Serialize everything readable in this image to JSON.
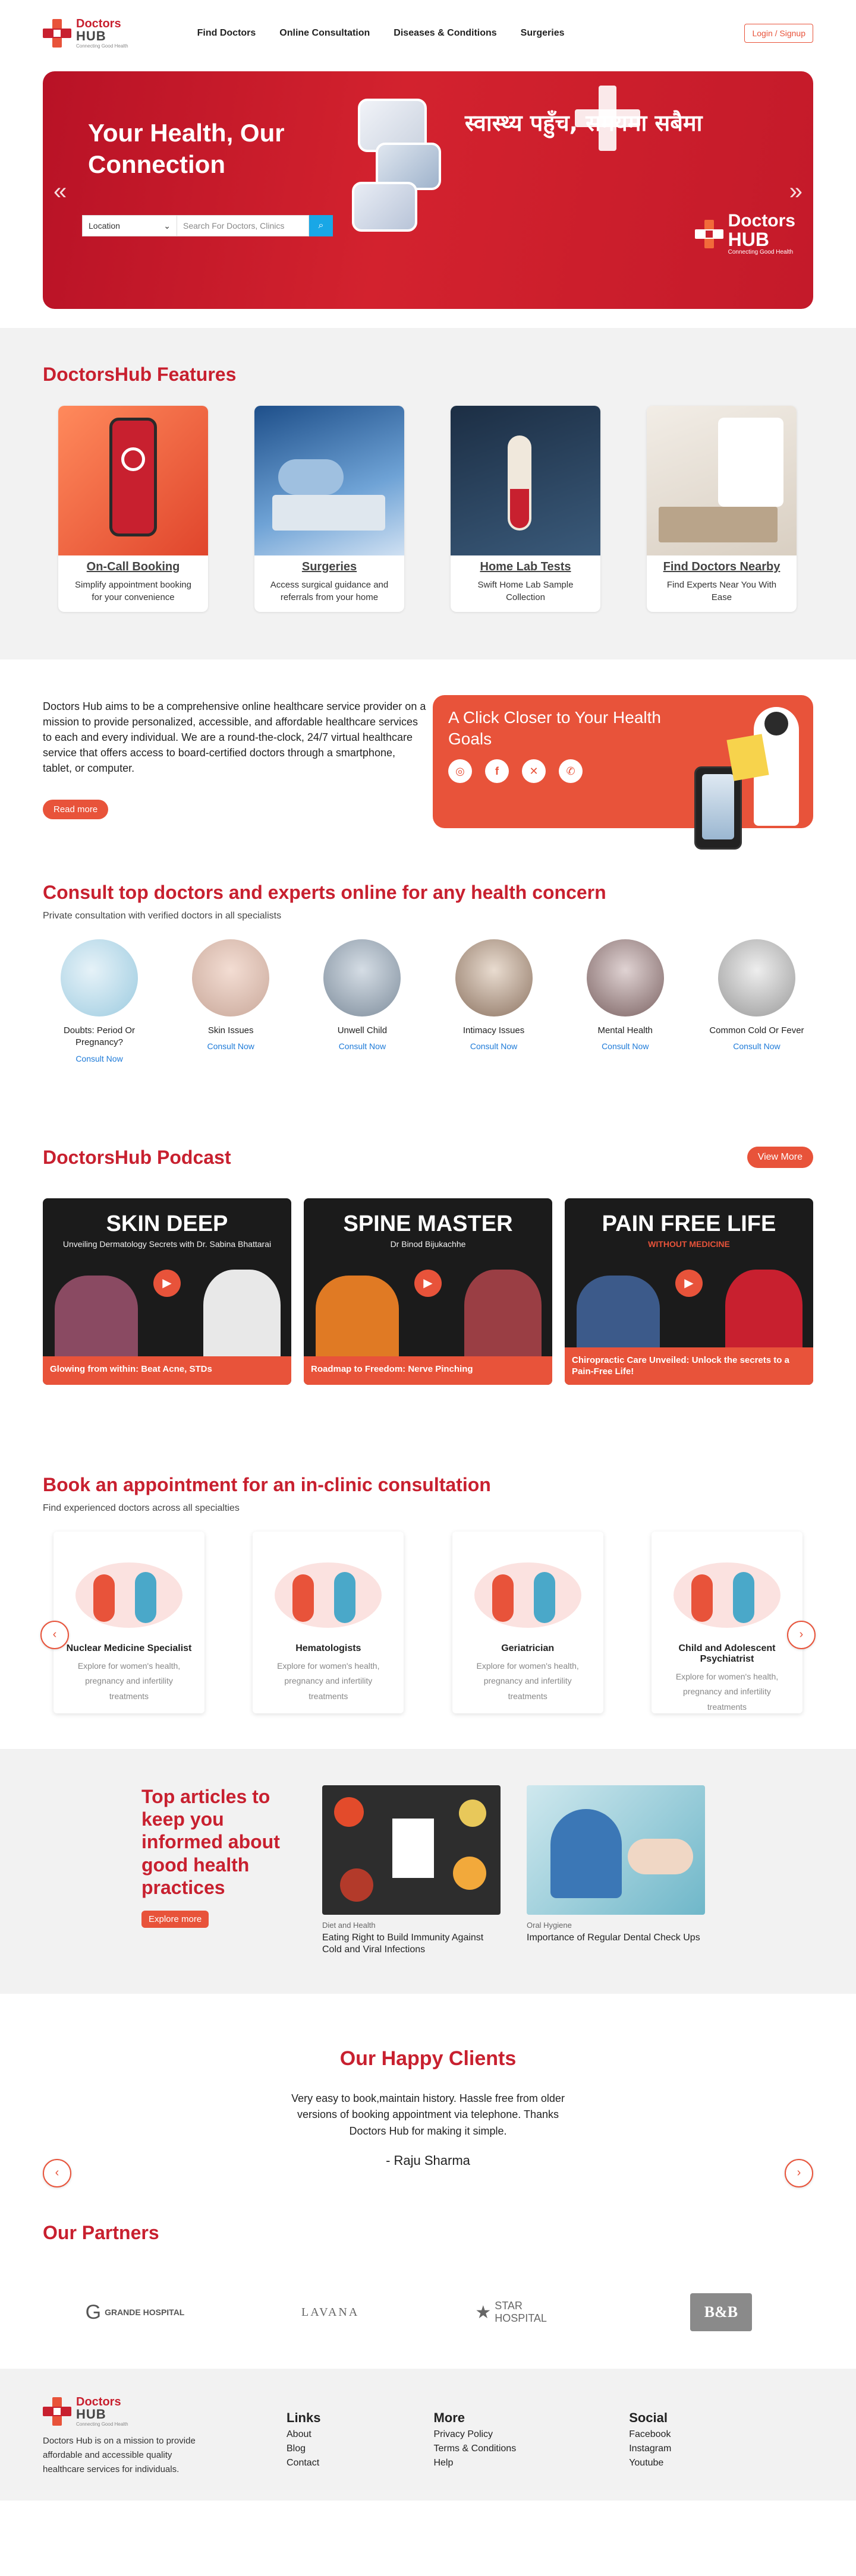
{
  "header": {
    "logo_line1": "Doctors",
    "logo_line2": "HUB",
    "logo_tag": "Connecting Good Health",
    "nav": [
      "Find Doctors",
      "Online Consultation",
      "Diseases & Conditions",
      "Surgeries"
    ],
    "login": "Login / Signup"
  },
  "hero": {
    "title": "Your Health, Our Connection",
    "location_label": "Location",
    "search_placeholder": "Search For Doctors, Clinics",
    "nepali": "स्वास्थ्य पहुँच, समयमा सबैमा",
    "badge_line1": "Doctors",
    "badge_line2": "HUB",
    "badge_tag": "Connecting Good Health"
  },
  "features": {
    "title": "DoctorsHub Features",
    "items": [
      {
        "title": "On-Call Booking",
        "desc": "Simplify appointment booking for your convenience"
      },
      {
        "title": "Surgeries",
        "desc": "Access surgical guidance and referrals from your home"
      },
      {
        "title": "Home Lab Tests",
        "desc": "Swift Home Lab Sample Collection"
      },
      {
        "title": "Find Doctors Nearby",
        "desc": "Find Experts Near You With Ease"
      }
    ]
  },
  "about": {
    "text": "Doctors Hub aims to be a comprehensive online healthcare service provider on a mission to provide personalized, accessible, and affordable healthcare services to each and every individual. We are a round-the-clock, 24/7 virtual healthcare service that offers access to board-certified doctors through a smartphone, tablet, or computer.",
    "button": "Read more",
    "card_title": "A Click Closer to Your Health Goals"
  },
  "consult": {
    "title": "Consult top doctors and experts online for any health concern",
    "subtitle": "Private consultation with verified doctors in all specialists",
    "cta": "Consult Now",
    "items": [
      "Doubts: Period Or Pregnancy?",
      "Skin Issues",
      "Unwell Child",
      "Intimacy Issues",
      "Mental Health",
      "Common Cold Or Fever"
    ]
  },
  "podcast": {
    "title": "DoctorsHub Podcast",
    "view_more": "View More",
    "items": [
      {
        "show": "SKIN DEEP",
        "sub": "Unveiling Dermatology Secrets with Dr. Sabina Bhattarai",
        "caption": "Glowing from within: Beat Acne, STDs"
      },
      {
        "show": "SPINE MASTER",
        "sub": "Dr Binod Bijukachhe",
        "caption": "Roadmap to Freedom: Nerve Pinching"
      },
      {
        "show": "PAIN FREE LIFE",
        "sub": "WITHOUT MEDICINE",
        "caption": "Chiropractic Care Unveiled: Unlock the secrets to a Pain-Free Life!"
      }
    ]
  },
  "appointment": {
    "title": "Book an appointment for an in-clinic consultation",
    "subtitle": "Find experienced doctors across all specialties",
    "desc": "Explore for women's health, pregnancy and infertility treatments",
    "items": [
      "Nuclear Medicine Specialist",
      "Hematologists",
      "Geriatrician",
      "Child and Adolescent Psychiatrist"
    ]
  },
  "articles": {
    "title": "Top articles to keep you informed about good health practices",
    "button": "Explore more",
    "items": [
      {
        "category": "Diet and Health",
        "title": "Eating Right to Build Immunity Against Cold and Viral Infections"
      },
      {
        "category": "Oral Hygiene",
        "title": "Importance of Regular Dental Check Ups"
      }
    ]
  },
  "testimonial": {
    "title": "Our Happy Clients",
    "quote": "Very easy to book,maintain history. Hassle free from older versions of booking appointment via telephone. Thanks Doctors Hub for making it simple.",
    "author": "- Raju Sharma"
  },
  "partners": {
    "title": "Our Partners",
    "items": [
      "GRANDE HOSPITAL",
      "LAVANA",
      "STAR HOSPITAL",
      "B&B"
    ]
  },
  "footer": {
    "desc": "Doctors Hub is on a mission to provide affordable and accessible quality healthcare services for individuals.",
    "cols": [
      {
        "title": "Links",
        "items": [
          "About",
          "Blog",
          "Contact"
        ]
      },
      {
        "title": "More",
        "items": [
          "Privacy Policy",
          "Terms & Conditions",
          "Help"
        ]
      },
      {
        "title": "Social",
        "items": [
          "Facebook",
          "Instagram",
          "Youtube"
        ]
      }
    ]
  },
  "colors": {
    "brand_red": "#c8202f",
    "accent_orange": "#e8533a",
    "link_blue": "#1d7ad8"
  }
}
